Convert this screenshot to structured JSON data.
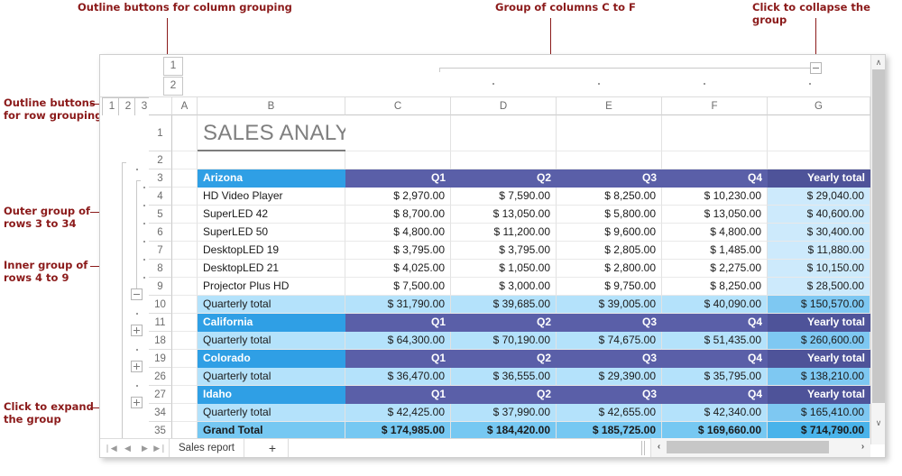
{
  "annotations": [
    {
      "id": "a-col-outline",
      "text": "Outline buttons for column grouping"
    },
    {
      "id": "a-col-group",
      "text": "Group of columns C to F"
    },
    {
      "id": "a-collapse",
      "text": "Click to collapse the group"
    },
    {
      "id": "a-row-outline",
      "text": "Outline buttons\nfor row grouping"
    },
    {
      "id": "a-outer",
      "text": "Outer group of\nrows 3 to 34"
    },
    {
      "id": "a-inner",
      "text": "Inner group of\nrows 4 to 9"
    },
    {
      "id": "a-expand",
      "text": "Click to expand\nthe group"
    }
  ],
  "spreadsheet": {
    "column_levels": [
      "1",
      "2"
    ],
    "row_levels": [
      "1",
      "2",
      "3"
    ],
    "column_headers": [
      "A",
      "B",
      "C",
      "D",
      "E",
      "F",
      "G"
    ],
    "row_headers": [
      "1",
      "2",
      "3",
      "4",
      "5",
      "6",
      "7",
      "8",
      "9",
      "10",
      "11",
      "18",
      "19",
      "26",
      "27",
      "34",
      "35"
    ],
    "title": "SALES ANALYSIS",
    "rows": [
      {
        "row": "1",
        "kind": "title",
        "b": "SALES ANALYSIS"
      },
      {
        "row": "2",
        "kind": "blank",
        "b": "",
        "c": "",
        "d": "",
        "e": "",
        "f": "",
        "g": ""
      },
      {
        "row": "3",
        "kind": "state",
        "b": "Arizona",
        "c": "Q1",
        "d": "Q2",
        "e": "Q3",
        "f": "Q4",
        "g": "Yearly total"
      },
      {
        "row": "4",
        "kind": "data",
        "b": "HD Video Player",
        "c": "$ 2,970.00",
        "d": "$ 7,590.00",
        "e": "$ 8,250.00",
        "f": "$ 10,230.00",
        "g": "$ 29,040.00"
      },
      {
        "row": "5",
        "kind": "data",
        "b": "SuperLED 42",
        "c": "$ 8,700.00",
        "d": "$ 13,050.00",
        "e": "$ 5,800.00",
        "f": "$ 13,050.00",
        "g": "$ 40,600.00"
      },
      {
        "row": "6",
        "kind": "data",
        "b": "SuperLED 50",
        "c": "$ 4,800.00",
        "d": "$ 11,200.00",
        "e": "$ 9,600.00",
        "f": "$ 4,800.00",
        "g": "$ 30,400.00"
      },
      {
        "row": "7",
        "kind": "data",
        "b": "DesktopLED 19",
        "c": "$ 3,795.00",
        "d": "$ 3,795.00",
        "e": "$ 2,805.00",
        "f": "$ 1,485.00",
        "g": "$ 11,880.00"
      },
      {
        "row": "8",
        "kind": "data",
        "b": "DesktopLED 21",
        "c": "$ 4,025.00",
        "d": "$ 1,050.00",
        "e": "$ 2,800.00",
        "f": "$ 2,275.00",
        "g": "$ 10,150.00"
      },
      {
        "row": "9",
        "kind": "data",
        "b": "Projector Plus HD",
        "c": "$ 7,500.00",
        "d": "$ 3,000.00",
        "e": "$ 9,750.00",
        "f": "$ 8,250.00",
        "g": "$ 28,500.00"
      },
      {
        "row": "10",
        "kind": "qtotal",
        "b": "Quarterly total",
        "c": "$ 31,790.00",
        "d": "$ 39,685.00",
        "e": "$ 39,005.00",
        "f": "$ 40,090.00",
        "g": "$ 150,570.00"
      },
      {
        "row": "11",
        "kind": "state",
        "b": "California",
        "c": "Q1",
        "d": "Q2",
        "e": "Q3",
        "f": "Q4",
        "g": "Yearly total"
      },
      {
        "row": "18",
        "kind": "qtotal",
        "b": "Quarterly total",
        "c": "$ 64,300.00",
        "d": "$ 70,190.00",
        "e": "$ 74,675.00",
        "f": "$ 51,435.00",
        "g": "$ 260,600.00"
      },
      {
        "row": "19",
        "kind": "state",
        "b": "Colorado",
        "c": "Q1",
        "d": "Q2",
        "e": "Q3",
        "f": "Q4",
        "g": "Yearly total"
      },
      {
        "row": "26",
        "kind": "qtotal",
        "b": "Quarterly total",
        "c": "$ 36,470.00",
        "d": "$ 36,555.00",
        "e": "$ 29,390.00",
        "f": "$ 35,795.00",
        "g": "$ 138,210.00"
      },
      {
        "row": "27",
        "kind": "state",
        "b": "Idaho",
        "c": "Q1",
        "d": "Q2",
        "e": "Q3",
        "f": "Q4",
        "g": "Yearly total"
      },
      {
        "row": "34",
        "kind": "qtotal",
        "b": "Quarterly total",
        "c": "$ 42,425.00",
        "d": "$ 37,990.00",
        "e": "$ 42,655.00",
        "f": "$ 42,340.00",
        "g": "$ 165,410.00"
      },
      {
        "row": "35",
        "kind": "grand",
        "b": "Grand Total",
        "c": "$ 174,985.00",
        "d": "$ 184,420.00",
        "e": "$ 185,725.00",
        "f": "$ 169,660.00",
        "g": "$ 714,790.00"
      }
    ],
    "tabbar": {
      "first_label": "❘◀",
      "prev_label": "◀",
      "next_label": "▶",
      "last_label": "▶❘",
      "sheet_name": "Sales report",
      "add_sheet_label": "+"
    },
    "scrollbars": {
      "up_label": "∧",
      "down_label": "∨",
      "left_label": "‹",
      "right_label": "›"
    },
    "colors": {
      "state_band": "#2f9fe5",
      "quarter_band": "#5a5fa8",
      "quarterly_total": "#b4e2fb",
      "yearly_total": "#cdeafc",
      "grand_total": "#76c8f2",
      "annotation": "#8b1a1a"
    }
  }
}
